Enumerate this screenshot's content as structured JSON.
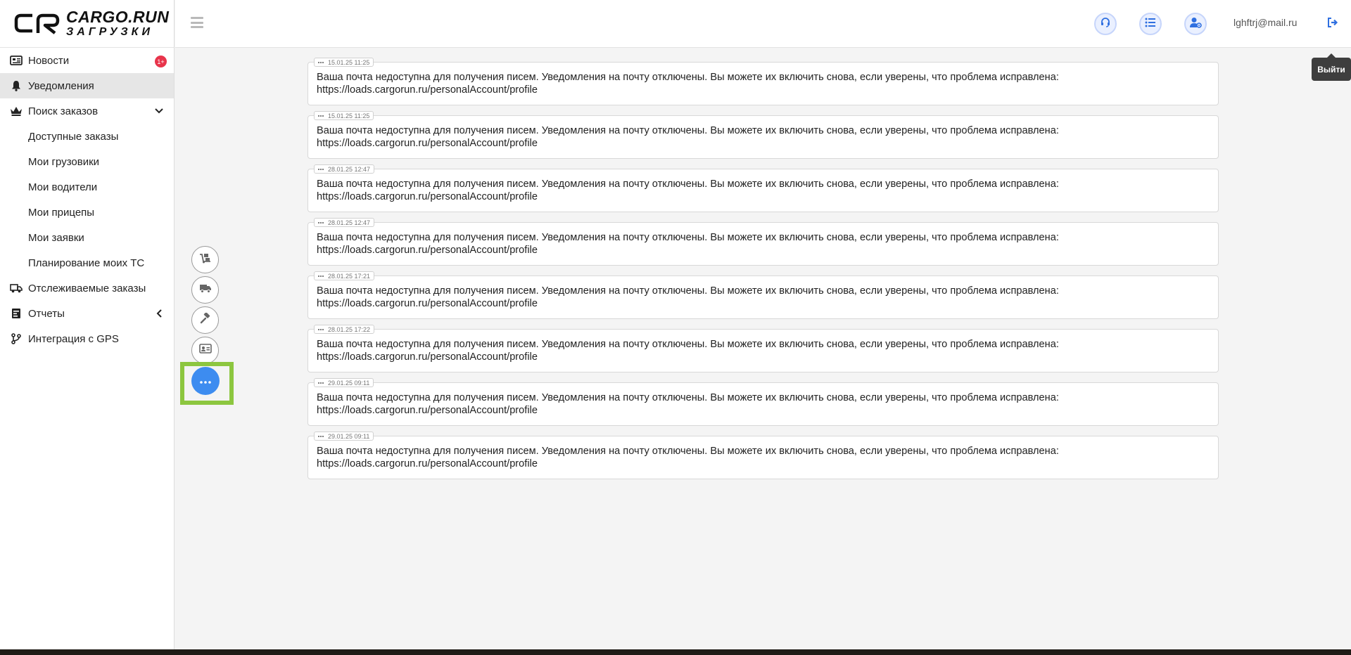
{
  "brand": {
    "title": "CARGO.RUN",
    "subtitle": "ЗАГРУЗКИ"
  },
  "sidebar": {
    "items": [
      {
        "label": "Новости",
        "icon": "newspaper-icon",
        "badge": "1+"
      },
      {
        "label": "Уведомления",
        "icon": "bell-icon",
        "active": true
      },
      {
        "label": "Поиск заказов",
        "icon": "crown-icon",
        "expanded": true
      },
      {
        "label": "Доступные заказы",
        "sub": true
      },
      {
        "label": "Мои грузовики",
        "sub": true
      },
      {
        "label": "Мои водители",
        "sub": true
      },
      {
        "label": "Мои прицепы",
        "sub": true
      },
      {
        "label": "Мои заявки",
        "sub": true
      },
      {
        "label": "Планирование моих ТС",
        "sub": true
      },
      {
        "label": "Отслеживаемые заказы",
        "icon": "truck-tracking-icon"
      },
      {
        "label": "Отчеты",
        "icon": "report-icon",
        "collapsed": true
      },
      {
        "label": "Интеграция с GPS",
        "icon": "git-branch-icon"
      }
    ]
  },
  "header": {
    "user_email": "lghftrj@mail.ru",
    "logout_tooltip": "Выйти",
    "accent_color": "#3d8cf0"
  },
  "notifications": [
    {
      "date": "15.01.25 11:25",
      "text_line1": "Ваша почта недоступна для получения писем. Уведомления на почту отключены. Вы можете их включить снова, если уверены, что проблема исправлена:",
      "text_line2": "https://loads.cargorun.ru/personalAccount/profile"
    },
    {
      "date": "15.01.25 11:25",
      "text_line1": "Ваша почта недоступна для получения писем. Уведомления на почту отключены. Вы можете их включить снова, если уверены, что проблема исправлена:",
      "text_line2": "https://loads.cargorun.ru/personalAccount/profile"
    },
    {
      "date": "28.01.25 12:47",
      "text_line1": "Ваша почта недоступна для получения писем. Уведомления на почту отключены. Вы можете их включить снова, если уверены, что проблема исправлена:",
      "text_line2": "https://loads.cargorun.ru/personalAccount/profile"
    },
    {
      "date": "28.01.25 12:47",
      "text_line1": "Ваша почта недоступна для получения писем. Уведомления на почту отключены. Вы можете их включить снова, если уверены, что проблема исправлена:",
      "text_line2": "https://loads.cargorun.ru/personalAccount/profile"
    },
    {
      "date": "28.01.25 17:21",
      "text_line1": "Ваша почта недоступна для получения писем. Уведомления на почту отключены. Вы можете их включить снова, если уверены, что проблема исправлена:",
      "text_line2": "https://loads.cargorun.ru/personalAccount/profile"
    },
    {
      "date": "28.01.25 17:22",
      "text_line1": "Ваша почта недоступна для получения писем. Уведомления на почту отключены. Вы можете их включить снова, если уверены, что проблема исправлена:",
      "text_line2": "https://loads.cargorun.ru/personalAccount/profile"
    },
    {
      "date": "29.01.25 09:11",
      "text_line1": "Ваша почта недоступна для получения писем. Уведомления на почту отключены. Вы можете их включить снова, если уверены, что проблема исправлена:",
      "text_line2": "https://loads.cargorun.ru/personalAccount/profile"
    },
    {
      "date": "29.01.25 09:11",
      "text_line1": "Ваша почта недоступна для получения писем. Уведомления на почту отключены. Вы можете их включить снова, если уверены, что проблема исправлена:",
      "text_line2": "https://loads.cargorun.ru/personalAccount/profile"
    }
  ]
}
